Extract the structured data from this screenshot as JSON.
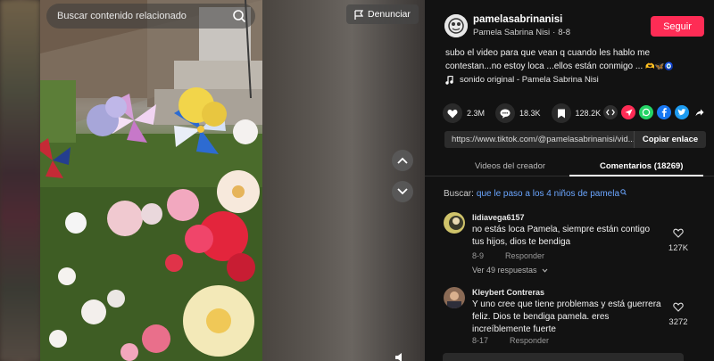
{
  "video": {
    "search_placeholder": "Buscar contenido relacionado",
    "report_label": "Denunciar"
  },
  "author": {
    "username": "pamelasabrinanisi",
    "nickname": "Pamela Sabrina Nisi",
    "date": "8-8",
    "follow_label": "Seguir"
  },
  "post": {
    "description": "subo el video para que vean q cuando les hablo me contestan...no estoy loca ...ellos están conmigo ...",
    "description_emojis": "🫶🦋🧿",
    "music": "sonido original - Pamela Sabrina Nisi"
  },
  "stats": {
    "likes": "2.3M",
    "comments": "18.3K",
    "saves": "128.2K"
  },
  "share": {
    "url": "https://www.tiktok.com/@pamelasabrinanisi/vid...",
    "copy_label": "Copiar enlace",
    "colors": {
      "embed": "#2f2f2f",
      "send": "#fe2c55",
      "whatsapp": "#25d366",
      "facebook": "#1877f2",
      "twitter": "#1d9bf0"
    }
  },
  "tabs": {
    "creator_videos": "Videos del creador",
    "comments": "Comentarios (18269)"
  },
  "related_search": {
    "label": "Buscar:",
    "query": "que le paso a los 4 niños de pamela"
  },
  "comments": [
    {
      "user": "lidiavega6157",
      "text": "no estás loca Pamela, siempre están contigo tus hijos, dios te bendiga",
      "date": "8-9",
      "reply_label": "Responder",
      "more_replies": "Ver 49 respuestas",
      "likes": "127K"
    },
    {
      "user": "Kleybert Contreras",
      "text": "Y uno cree que tiene problemas y está guerrera feliz. Dios te bendiga pamela. eres increíblemente fuerte",
      "date": "8-17",
      "reply_label": "Responder",
      "likes": "3272"
    }
  ],
  "accent_color": "#fe2c55"
}
